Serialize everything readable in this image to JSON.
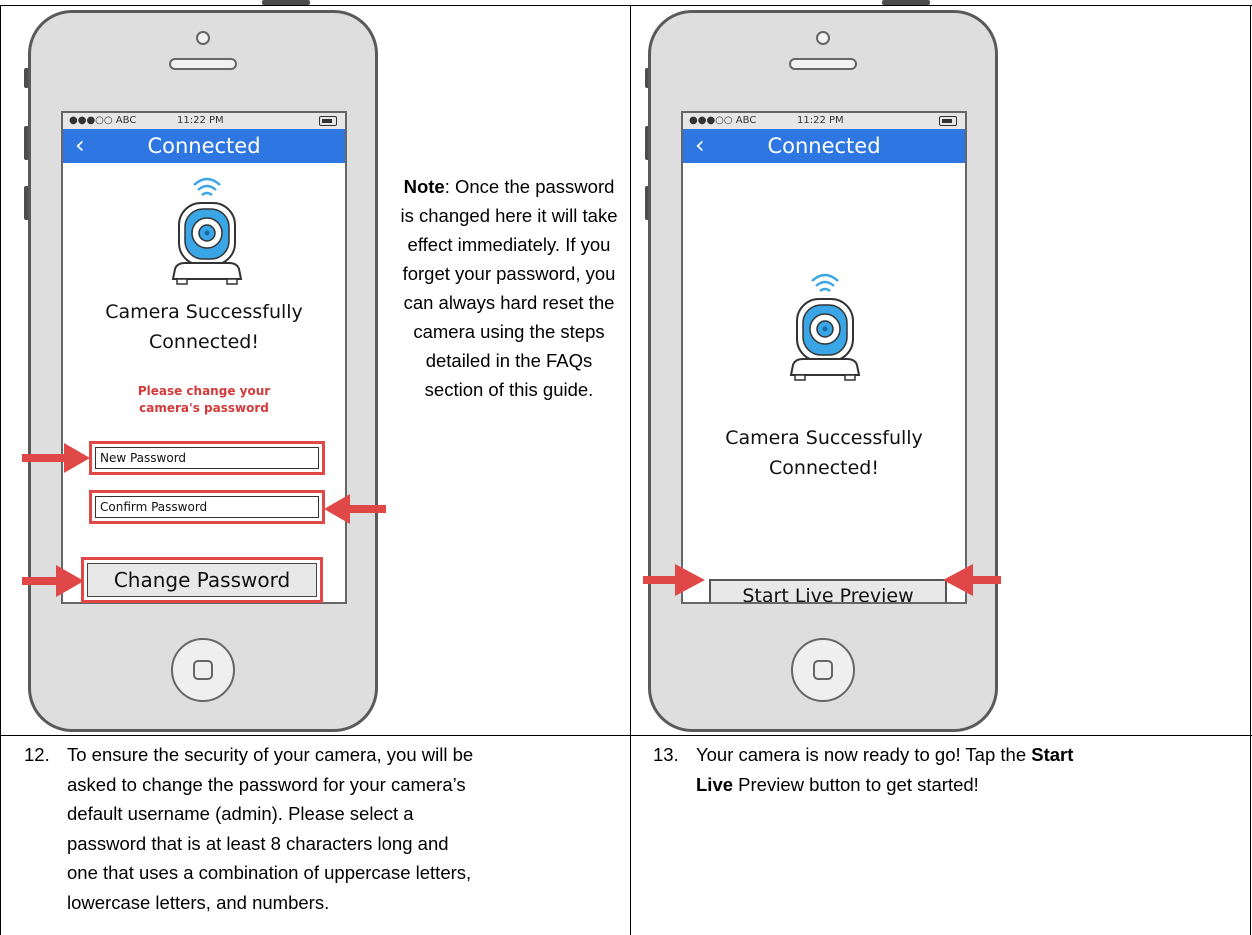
{
  "phone_left": {
    "status": {
      "carrier": "●●●○○ ABC",
      "time": "11:22 PM"
    },
    "nav": {
      "back": "‹",
      "title": "Connected"
    },
    "success_line1": "Camera Successfully",
    "success_line2": "Connected!",
    "prompt_line1": "Please change your",
    "prompt_line2": "camera's password",
    "new_password_placeholder": "New Password",
    "confirm_password_placeholder": "Confirm Password",
    "change_button": "Change Password"
  },
  "phone_right": {
    "status": {
      "carrier": "●●●○○ ABC",
      "time": "11:22 PM"
    },
    "nav": {
      "back": "‹",
      "title": "Connected"
    },
    "success_line1": "Camera Successfully",
    "success_line2": "Connected!",
    "start_button": "Start Live Preview"
  },
  "note": {
    "label": "Note",
    "text": ": Once the password is changed here it will take effect immediately. If you forget your password, you can always hard reset the camera using the steps detailed in the FAQs section of this guide."
  },
  "steps": [
    {
      "number": "12.",
      "lines": [
        "To ensure the security of your camera, you will be",
        "asked to change the password for your camera’s",
        "default username (admin). Please select a",
        "password that is at least 8 characters long and",
        "one that uses a combination of uppercase letters,",
        "lowercase letters, and numbers."
      ]
    },
    {
      "number": "13.",
      "line1_pre": "Your camera is now ready to go! Tap the ",
      "line1_bold": "Start",
      "line2_bold": "Live",
      "line2_post": " Preview button to get started!"
    }
  ],
  "colors": {
    "nav_blue": "#2e77e3",
    "arrow_red": "#e04848",
    "camera_blue": "#3aa6e6"
  }
}
